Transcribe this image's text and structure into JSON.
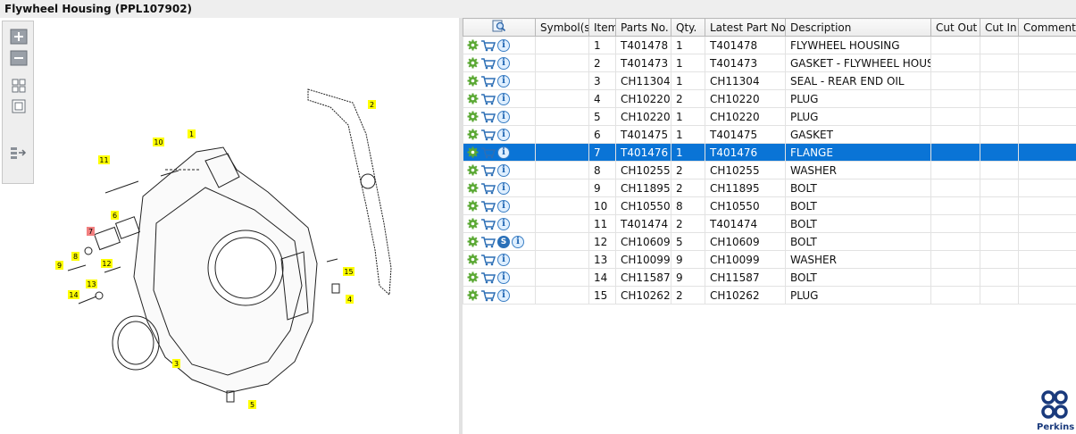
{
  "window": {
    "title": "Flywheel Housing (PPL107902)"
  },
  "toolbar": {
    "buttons": [
      {
        "name": "zoom-in-button",
        "icon": "zoom-in-icon"
      },
      {
        "name": "zoom-out-button",
        "icon": "zoom-out-icon"
      },
      {
        "name": "fit-all-button",
        "icon": "fit-all-icon"
      },
      {
        "name": "fit-window-button",
        "icon": "fit-window-icon"
      },
      {
        "name": "panel-toggle-button",
        "icon": "panel-toggle-icon"
      }
    ]
  },
  "diagram": {
    "callouts": [
      {
        "label": "1"
      },
      {
        "label": "2"
      },
      {
        "label": "3"
      },
      {
        "label": "4"
      },
      {
        "label": "5"
      },
      {
        "label": "6"
      },
      {
        "label": "7",
        "highlight": true
      },
      {
        "label": "8"
      },
      {
        "label": "9"
      },
      {
        "label": "10"
      },
      {
        "label": "11"
      },
      {
        "label": "12"
      },
      {
        "label": "13"
      },
      {
        "label": "14"
      },
      {
        "label": "15"
      }
    ],
    "callout_color": "#ffff00",
    "highlight_color": "#f28080"
  },
  "table": {
    "columns": [
      "",
      "Symbol(s)",
      "Item",
      "Parts No.",
      "Qty.",
      "Latest Part No.",
      "Description",
      "Cut Out",
      "Cut In",
      "Comment"
    ],
    "selected_row_color": "#0a74d6",
    "rows": [
      {
        "item": "1",
        "part_no": "T401478",
        "qty": "1",
        "latest": "T401478",
        "description": "FLYWHEEL HOUSING"
      },
      {
        "item": "2",
        "part_no": "T401473",
        "qty": "1",
        "latest": "T401473",
        "description": "GASKET - FLYWHEEL HOUSING"
      },
      {
        "item": "3",
        "part_no": "CH11304",
        "qty": "1",
        "latest": "CH11304",
        "description": "SEAL - REAR END OIL"
      },
      {
        "item": "4",
        "part_no": "CH10220",
        "qty": "2",
        "latest": "CH10220",
        "description": "PLUG"
      },
      {
        "item": "5",
        "part_no": "CH10220",
        "qty": "1",
        "latest": "CH10220",
        "description": "PLUG"
      },
      {
        "item": "6",
        "part_no": "T401475",
        "qty": "1",
        "latest": "T401475",
        "description": "GASKET"
      },
      {
        "item": "7",
        "part_no": "T401476",
        "qty": "1",
        "latest": "T401476",
        "description": "FLANGE",
        "selected": true
      },
      {
        "item": "8",
        "part_no": "CH10255",
        "qty": "2",
        "latest": "CH10255",
        "description": "WASHER"
      },
      {
        "item": "9",
        "part_no": "CH11895",
        "qty": "2",
        "latest": "CH11895",
        "description": "BOLT"
      },
      {
        "item": "10",
        "part_no": "CH10550",
        "qty": "8",
        "latest": "CH10550",
        "description": "BOLT"
      },
      {
        "item": "11",
        "part_no": "T401474",
        "qty": "2",
        "latest": "T401474",
        "description": "BOLT"
      },
      {
        "item": "12",
        "part_no": "CH10609",
        "qty": "5",
        "latest": "CH10609",
        "description": "BOLT",
        "symbol": "S"
      },
      {
        "item": "13",
        "part_no": "CH10099",
        "qty": "9",
        "latest": "CH10099",
        "description": "WASHER"
      },
      {
        "item": "14",
        "part_no": "CH11587",
        "qty": "9",
        "latest": "CH11587",
        "description": "BOLT"
      },
      {
        "item": "15",
        "part_no": "CH10262",
        "qty": "2",
        "latest": "CH10262",
        "description": "PLUG"
      }
    ]
  },
  "logo": {
    "text": "Perkins",
    "color": "#1a3a7c"
  }
}
